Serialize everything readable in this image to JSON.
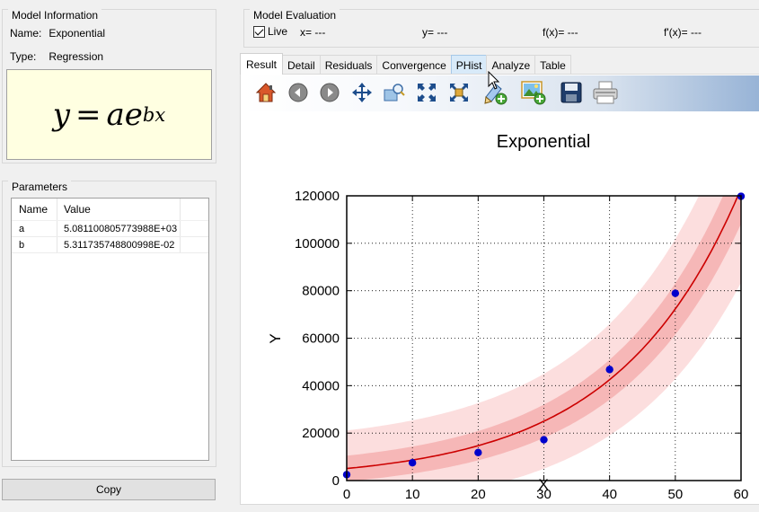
{
  "model_info": {
    "title": "Model Information",
    "name_label": "Name:",
    "name_value": "Exponential",
    "type_label": "Type:",
    "type_value": "Regression",
    "formula": {
      "lhs": "y",
      "eq": "=",
      "a": "a",
      "e": "e",
      "exponent": "bx"
    }
  },
  "parameters": {
    "title": "Parameters",
    "columns": [
      "Name",
      "Value"
    ],
    "rows": [
      {
        "name": "a",
        "value": "5.081100805773988E+03"
      },
      {
        "name": "b",
        "value": "5.311735748800998E-02"
      }
    ]
  },
  "copy_label": "Copy",
  "evaluation": {
    "title": "Model Evaluation",
    "live_label": "Live",
    "live_checked": true,
    "x": "x= ---",
    "y": "y= ---",
    "fx": "f(x)= ---",
    "dfx": "f'(x)= ---"
  },
  "tabs": [
    "Result",
    "Detail",
    "Residuals",
    "Convergence",
    "PHist",
    "Analyze",
    "Table"
  ],
  "active_tab": "Result",
  "hover_tab": "PHist",
  "toolbar_icons": [
    "home-icon",
    "back-icon",
    "forward-icon",
    "pan-icon",
    "zoom-icon",
    "fit-icon",
    "fit-selection-icon",
    "edit-icon",
    "add-image-icon",
    "save-icon",
    "print-icon"
  ],
  "chart_data": {
    "type": "scatter",
    "title": "Exponential",
    "xlabel": "X",
    "ylabel": "Y",
    "xlim": [
      0,
      60
    ],
    "ylim": [
      0,
      120000
    ],
    "xticks": [
      0,
      10,
      20,
      30,
      40,
      50,
      60
    ],
    "yticks": [
      0,
      20000,
      40000,
      60000,
      80000,
      100000,
      120000
    ],
    "grid": true,
    "points": {
      "x": [
        0,
        10,
        20,
        30,
        40,
        50,
        60
      ],
      "y": [
        2500,
        7500,
        11800,
        17200,
        46800,
        78900,
        119800
      ],
      "color": "#0000cc"
    },
    "fit": {
      "a": 5081.100805773988,
      "b": 0.05311735748800998,
      "color": "#cc0000"
    },
    "bands": [
      {
        "name": "inner",
        "offset": 5000,
        "scale": 0.08,
        "color": "#f4a9a9"
      },
      {
        "name": "outer",
        "offset": 15000,
        "scale": 0.2,
        "color": "#fbd3d3"
      }
    ]
  }
}
